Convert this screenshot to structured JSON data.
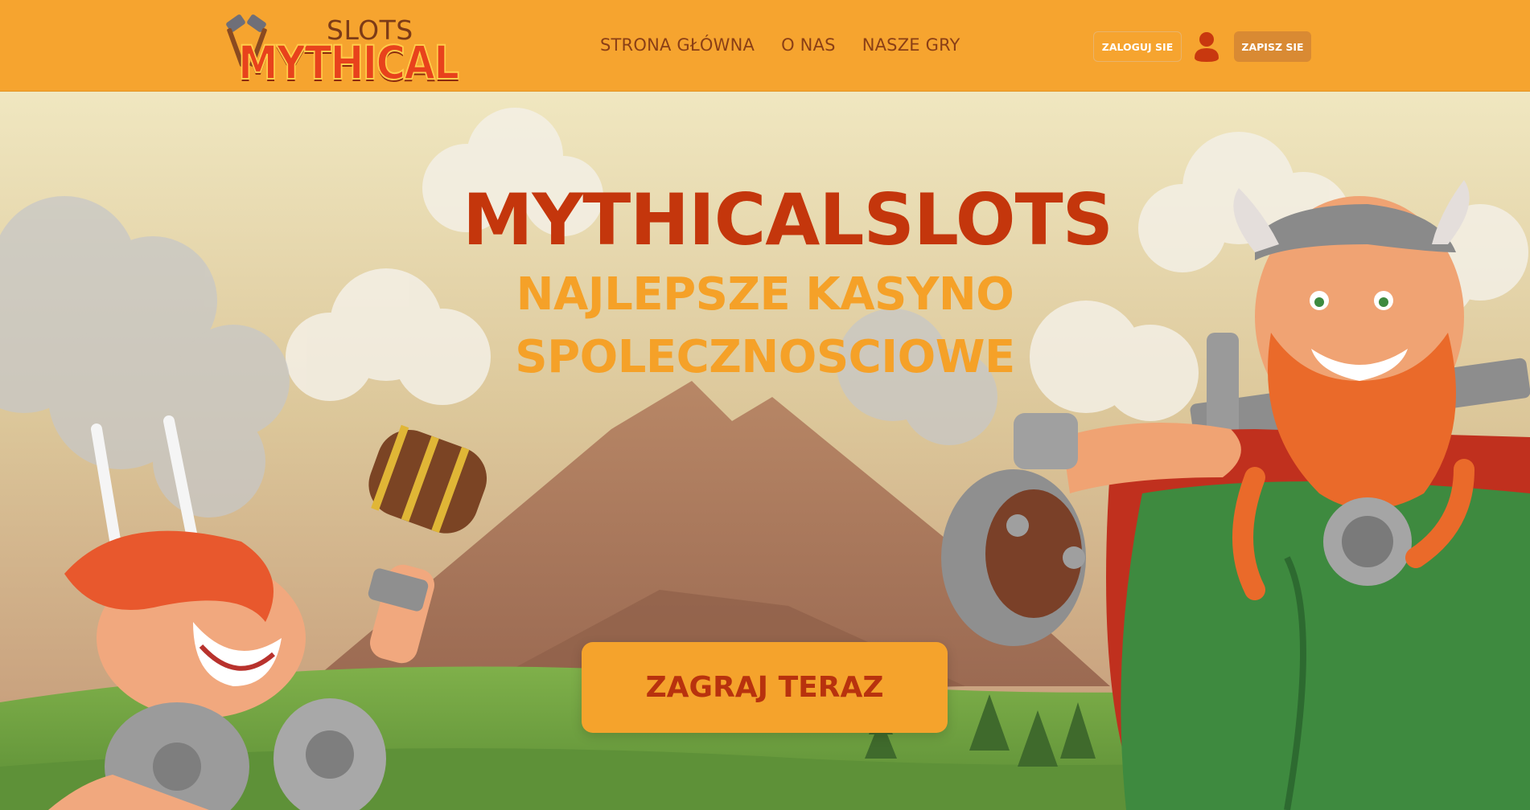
{
  "header": {
    "logo_top": "SLOTS",
    "logo_main": "MYTHICAL",
    "nav": [
      {
        "label": "STRONA GŁÓWNA"
      },
      {
        "label": "O NAS"
      },
      {
        "label": "NASZE GRY"
      }
    ],
    "login_label": "ZALOGUJ SIE",
    "signup_label": "ZAPISZ SIE",
    "user_icon": "user-icon"
  },
  "hero": {
    "title": "MYTHICALSLOTS",
    "subtitle_line1": "NAJLEPSZE KASYNO",
    "subtitle_line2": "SPOLECZNOSCIOWE",
    "cta_label": "ZAGRAJ TERAZ"
  },
  "colors": {
    "header_bg": "#f6a42f",
    "title": "#c4360c",
    "subtitle": "#f5a128",
    "cta_bg": "#f5a32c",
    "cta_text": "#b8320e"
  }
}
